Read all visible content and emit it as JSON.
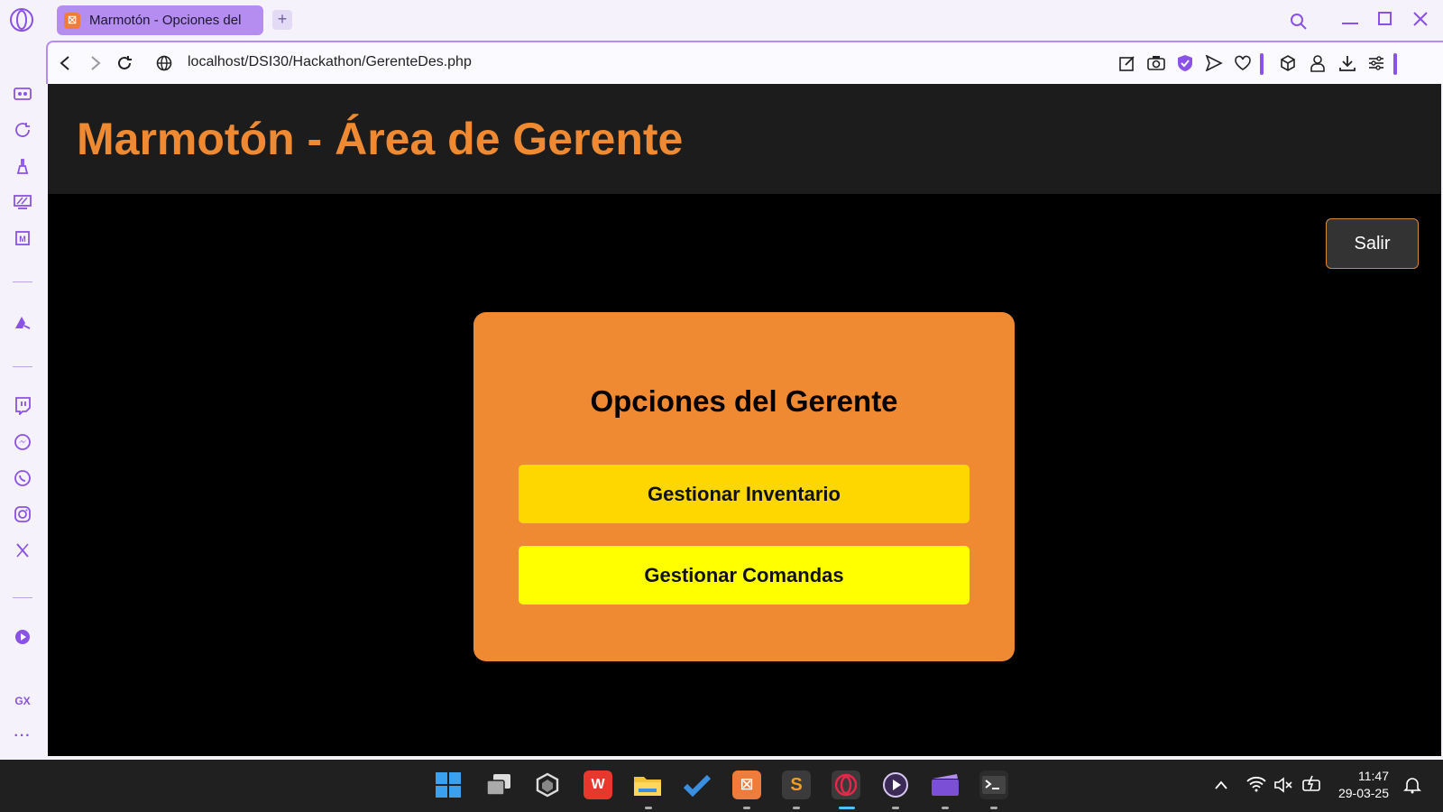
{
  "browser": {
    "tab_title": "Marmotón - Opciones del",
    "tab_favicon": "xampp-icon",
    "new_tab_label": "+",
    "url": "localhost/DSI30/Hackathon/GerenteDes.php",
    "sidebar_text_item": "GX",
    "accent_color": "#8a52e6"
  },
  "page": {
    "header_title": "Marmotón - Área de Gerente",
    "logout_label": "Salir",
    "card_title": "Opciones del Gerente",
    "options": [
      {
        "label": "Gestionar Inventario",
        "color": "#ffd700"
      },
      {
        "label": "Gestionar Comandas",
        "color": "#ffff00"
      }
    ],
    "header_color": "#ef8a32"
  },
  "taskbar": {
    "apps": [
      "windows-start-icon",
      "task-view-icon",
      "unity-icon",
      "wps-office-icon",
      "file-explorer-icon",
      "todo-icon",
      "xampp-icon",
      "sublime-text-icon",
      "opera-gx-icon",
      "media-player-icon",
      "clipchamp-icon",
      "terminal-icon"
    ],
    "time": "11:47",
    "date": "29-03-25"
  }
}
